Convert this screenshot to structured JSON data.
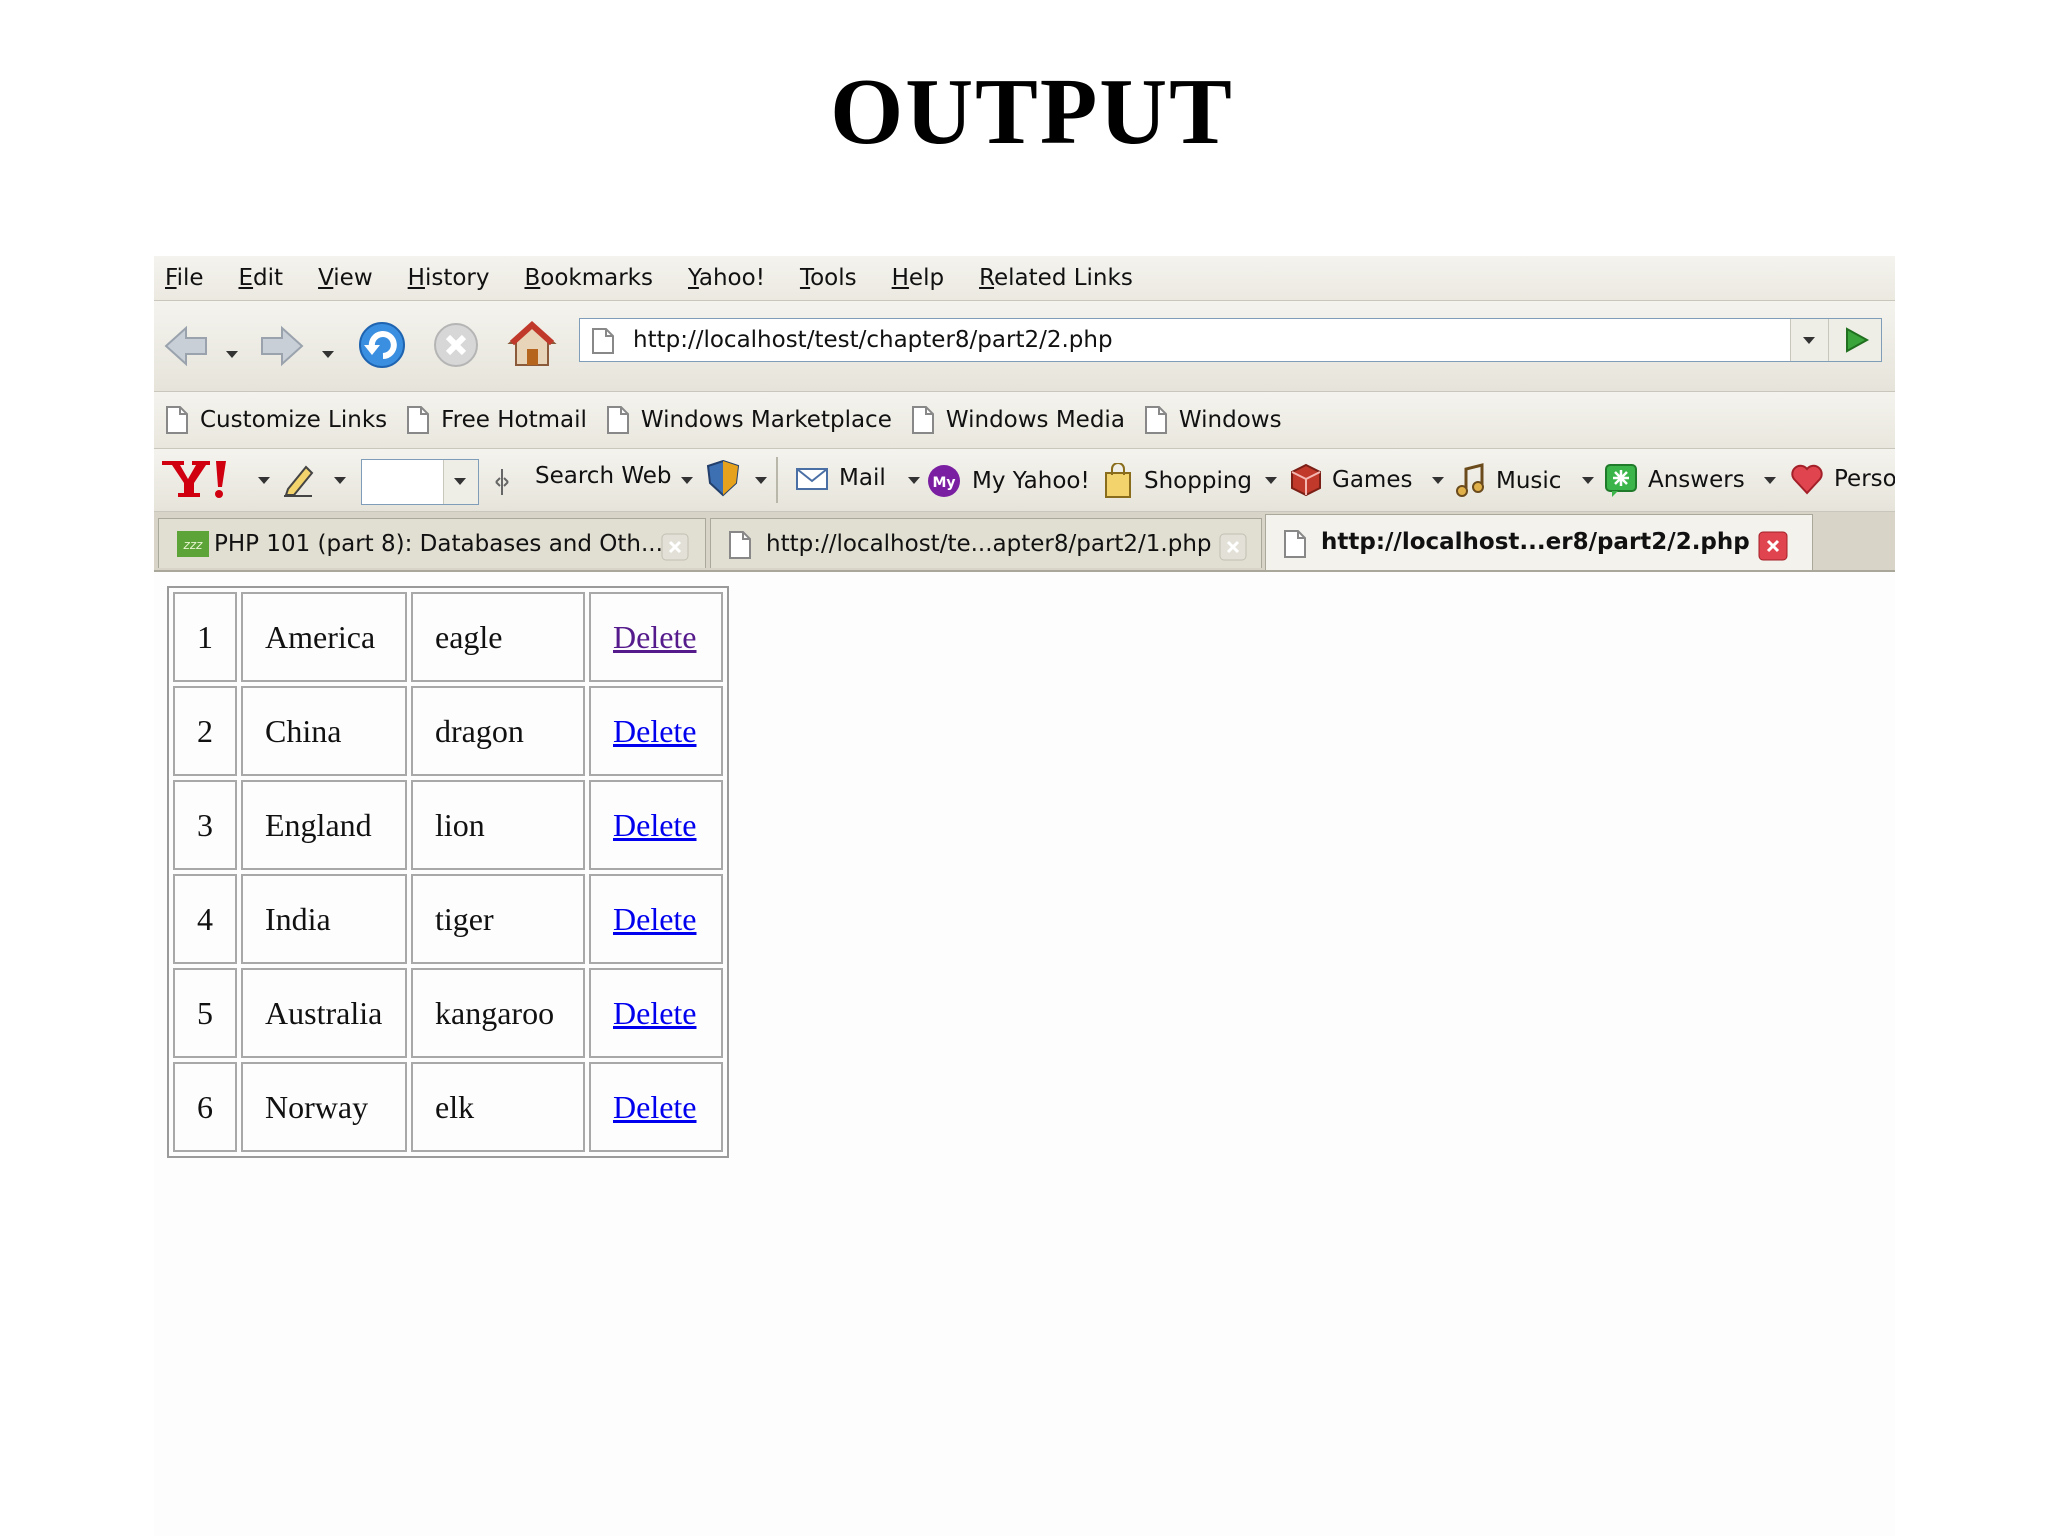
{
  "slide": {
    "title": "OUTPUT"
  },
  "browser": {
    "menu": [
      "File",
      "Edit",
      "View",
      "History",
      "Bookmarks",
      "Yahoo!",
      "Tools",
      "Help",
      "Related Links"
    ],
    "address": {
      "url": "http://localhost/test/chapter8/part2/2.php"
    },
    "links": [
      "Customize Links",
      "Free Hotmail",
      "Windows Marketplace",
      "Windows Media",
      "Windows"
    ],
    "yahoo_toolbar": {
      "search_label": "Search Web",
      "items": [
        "Mail",
        "My Yahoo!",
        "Shopping",
        "Games",
        "Music",
        "Answers",
        "Perso"
      ]
    },
    "tabs": [
      {
        "title": "PHP 101 (part 8): Databases and Oth...",
        "active": false
      },
      {
        "title": "http://localhost/te...apter8/part2/1.php",
        "active": false
      },
      {
        "title": "http://localhost...er8/part2/2.php",
        "active": true
      }
    ]
  },
  "table": {
    "rows": [
      {
        "id": "1",
        "country": "America",
        "animal": "eagle",
        "action": "Delete",
        "visited": true
      },
      {
        "id": "2",
        "country": "China",
        "animal": "dragon",
        "action": "Delete",
        "visited": false
      },
      {
        "id": "3",
        "country": "England",
        "animal": "lion",
        "action": "Delete",
        "visited": false
      },
      {
        "id": "4",
        "country": "India",
        "animal": "tiger",
        "action": "Delete",
        "visited": false
      },
      {
        "id": "5",
        "country": "Australia",
        "animal": "kangaroo",
        "action": "Delete",
        "visited": false
      },
      {
        "id": "6",
        "country": "Norway",
        "animal": "elk",
        "action": "Delete",
        "visited": false
      }
    ]
  },
  "colors": {
    "link": "#0000ee",
    "visited_link": "#551a8b",
    "close_active": "#e0454f"
  }
}
